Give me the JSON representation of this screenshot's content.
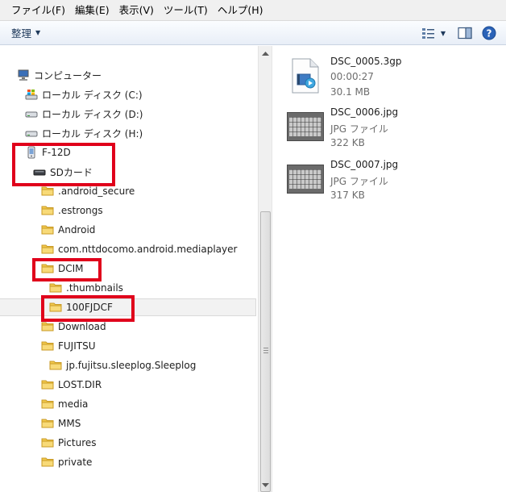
{
  "menubar": {
    "items": [
      {
        "label": "ファイル(F)"
      },
      {
        "label": "編集(E)"
      },
      {
        "label": "表示(V)"
      },
      {
        "label": "ツール(T)"
      },
      {
        "label": "ヘルプ(H)"
      }
    ]
  },
  "toolbar": {
    "organize_label": "整理"
  },
  "tree": {
    "computer": "コンピューター",
    "drive_c": "ローカル ディスク (C:)",
    "drive_d": "ローカル ディスク (D:)",
    "drive_h": "ローカル ディスク (H:)",
    "device": "F-12D",
    "sdcard": "SDカード",
    "folders": {
      "android_secure": ".android_secure",
      "estrongs": ".estrongs",
      "android": "Android",
      "mediaplayer": "com.nttdocomo.android.mediaplayer",
      "dcim": "DCIM",
      "thumbnails": ".thumbnails",
      "fjdcf": "100FJDCF",
      "download": "Download",
      "fujitsu": "FUJITSU",
      "sleeplog": "jp.fujitsu.sleeplog.Sleeplog",
      "lostdir": "LOST.DIR",
      "media": "media",
      "mms": "MMS",
      "pictures": "Pictures",
      "private": "private"
    },
    "selected": "100FJDCF"
  },
  "files": [
    {
      "name": "DSC_0005.3gp",
      "meta1": "00:00:27",
      "meta2": "30.1 MB",
      "icon": "video-file-icon"
    },
    {
      "name": "DSC_0006.jpg",
      "meta1": "JPG ファイル",
      "meta2": "322 KB",
      "icon": "photo-thumbnail"
    },
    {
      "name": "DSC_0007.jpg",
      "meta1": "JPG ファイル",
      "meta2": "317 KB",
      "icon": "photo-thumbnail"
    }
  ],
  "colors": {
    "highlight": "#e0001b",
    "folder": "#f2c94c",
    "toolbar_text": "#1e395b"
  }
}
